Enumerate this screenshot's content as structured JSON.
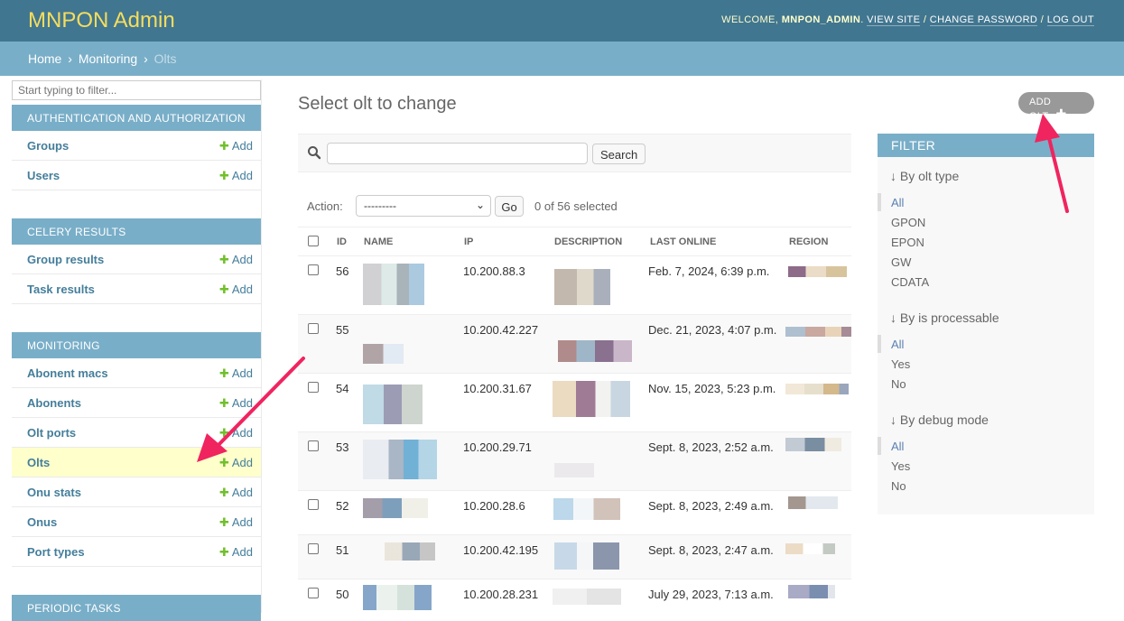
{
  "header": {
    "brand": "MNPON Admin",
    "welcome": "WELCOME,",
    "username": "MNPON_ADMIN",
    "period": ".",
    "view_site": "VIEW SITE",
    "change_password": "CHANGE PASSWORD",
    "log_out": "LOG OUT",
    "sep": "/"
  },
  "breadcrumbs": {
    "home": "Home",
    "section": "Monitoring",
    "current": "Olts",
    "sep": "›"
  },
  "sidebar": {
    "filter_placeholder": "Start typing to filter...",
    "add_label": "Add",
    "modules": [
      {
        "caption": "AUTHENTICATION AND AUTHORIZATION",
        "items": [
          "Groups",
          "Users"
        ]
      },
      {
        "caption": "CELERY RESULTS",
        "items": [
          "Group results",
          "Task results"
        ]
      },
      {
        "caption": "MONITORING",
        "items": [
          "Abonent macs",
          "Abonents",
          "Olt ports",
          "Olts",
          "Onu stats",
          "Onus",
          "Port types"
        ]
      },
      {
        "caption": "PERIODIC TASKS",
        "items": []
      }
    ],
    "selected_item": "Olts"
  },
  "main": {
    "title": "Select olt to change",
    "add_button": "ADD OLT",
    "search_button": "Search",
    "action_label": "Action:",
    "action_value": "---------",
    "go_label": "Go",
    "selected_count": "0 of 56 selected",
    "columns": [
      "ID",
      "NAME",
      "IP",
      "DESCRIPTION",
      "LAST ONLINE",
      "REGION"
    ],
    "rows": [
      {
        "id": "56",
        "ip": "10.200.88.3",
        "last_online": "Feb. 7, 2024, 6:39 p.m."
      },
      {
        "id": "55",
        "ip": "10.200.42.227",
        "last_online": "Dec. 21, 2023, 4:07 p.m."
      },
      {
        "id": "54",
        "ip": "10.200.31.67",
        "last_online": "Nov. 15, 2023, 5:23 p.m."
      },
      {
        "id": "53",
        "ip": "10.200.29.71",
        "last_online": "Sept. 8, 2023, 2:52 a.m."
      },
      {
        "id": "52",
        "ip": "10.200.28.6",
        "last_online": "Sept. 8, 2023, 2:49 a.m."
      },
      {
        "id": "51",
        "ip": "10.200.42.195",
        "last_online": "Sept. 8, 2023, 2:47 a.m."
      },
      {
        "id": "50",
        "ip": "10.200.28.231",
        "last_online": "July 29, 2023, 7:13 a.m."
      }
    ]
  },
  "filter": {
    "title": "FILTER",
    "groups": [
      {
        "heading": "↓ By olt type",
        "options": [
          "All",
          "GPON",
          "EPON",
          "GW",
          "CDATA"
        ]
      },
      {
        "heading": "↓ By is processable",
        "options": [
          "All",
          "Yes",
          "No"
        ]
      },
      {
        "heading": "↓ By debug mode",
        "options": [
          "All",
          "Yes",
          "No"
        ]
      }
    ]
  },
  "colors": {
    "header_bg": "#417690",
    "brand": "#f5dd5d",
    "breadcrumb_bg": "#79aec8",
    "link": "#447e9b",
    "add_plus": "#70bf2b",
    "selected_row": "#ffffcc",
    "arrow": "#f0245f"
  }
}
